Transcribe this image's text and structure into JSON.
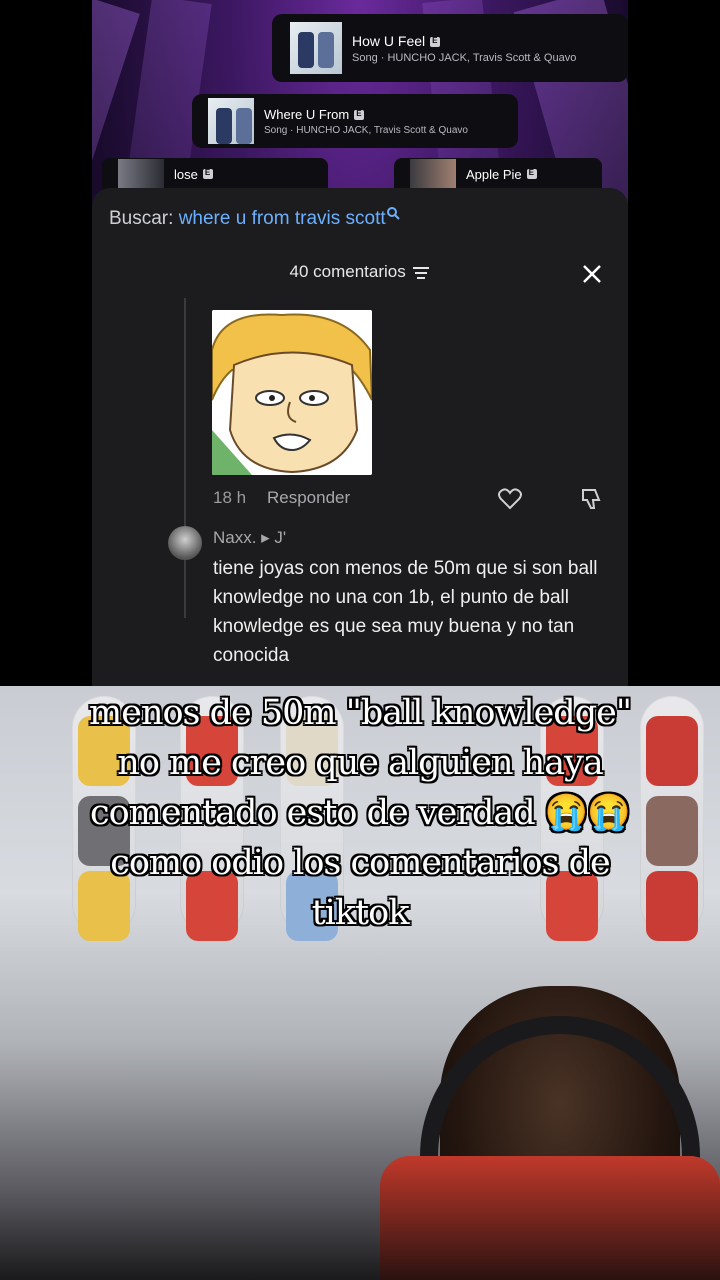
{
  "songs": [
    {
      "title": "How U Feel",
      "subtitle": "Song · HUNCHO JACK, Travis Scott & Quavo"
    },
    {
      "title": "Where U From",
      "subtitle": "Song · HUNCHO JACK, Travis Scott & Quavo"
    }
  ],
  "mini_songs": [
    {
      "title": "lose"
    },
    {
      "title": "Apple Pie"
    }
  ],
  "search": {
    "label": "Buscar:",
    "query": "where u from travis scott"
  },
  "comments": {
    "header": "40 comentarios",
    "sticker_comment": {
      "time": "18 h",
      "reply_label": "Responder"
    },
    "reply": {
      "author": "Naxx. ▸ J'",
      "text": "tiene joyas con menos de 50m que si son ball knowledge no una con 1b, el punto de ball knowledge es que sea muy buena y no tan conocida"
    }
  },
  "caption": "menos de 50m \"ball knowledge\" no me creo que alguien haya comentado esto de verdad 😭😭 como odio los comentarios de tiktok",
  "colors": {
    "link_blue": "#6ab0ff",
    "sheet_bg": "#1c1c1e"
  }
}
